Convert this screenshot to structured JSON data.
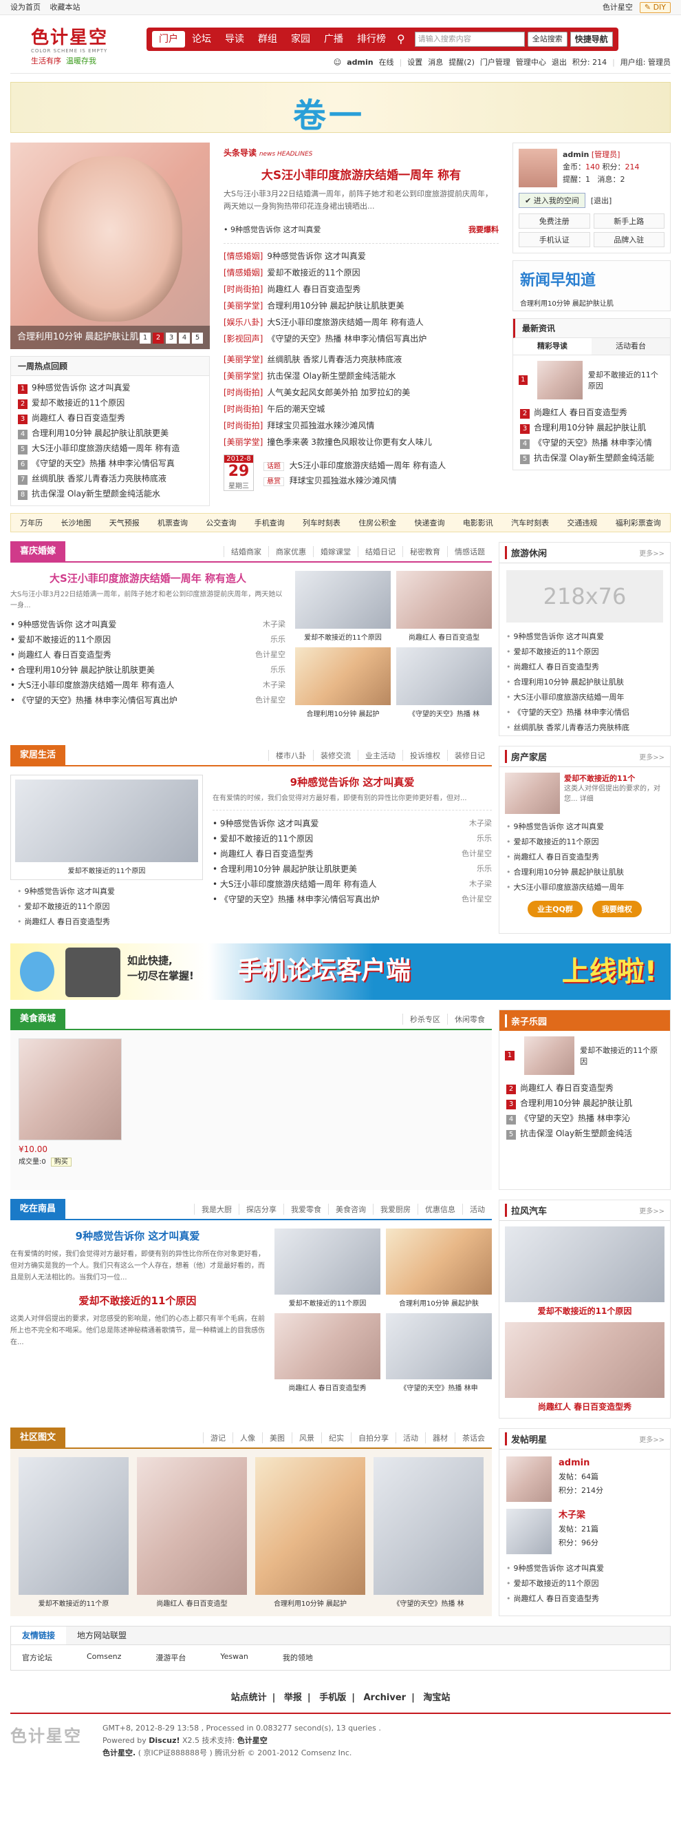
{
  "topbar": {
    "set_home": "设为首页",
    "bookmark": "收藏本站",
    "style": "色计星空",
    "diy": "DIY"
  },
  "logo": {
    "name": "色计星空",
    "en": "COLOR SCHEME IS EMPTY",
    "slogan_a": "生活有序",
    "slogan_b": "温暖存我"
  },
  "nav": {
    "items": [
      "门户",
      "论坛",
      "导读",
      "群组",
      "家园",
      "广播",
      "排行榜"
    ],
    "search_placeholder": "请输入搜索内容",
    "search_btn": "全站搜索",
    "quick_nav": "快捷导航"
  },
  "userbar": {
    "user": "admin",
    "status": "在线",
    "items": [
      "设置",
      "消息",
      "提醒(2)",
      "门户管理",
      "管理中心",
      "退出"
    ],
    "points": "积分: 214",
    "group": "用户组: 管理员"
  },
  "banner1": {
    "text": "卷一"
  },
  "slide": {
    "caption": "合理利用10分钟 晨起护肤让肌",
    "nums": [
      "1",
      "2",
      "3",
      "4",
      "5"
    ]
  },
  "hot": {
    "title": "一周热点回顾",
    "items": [
      "9种感觉告诉你 这才叫真爱",
      "爱却不敢接近的11个原因",
      "尚趣红人 春日百变造型秀",
      "合理利用10分钟 晨起护肤让肌肤更美",
      "大S汪小菲印度旅游庆结婚一周年 称有造",
      "《守望的天空》热播 林申李沁情侣写真",
      "丝绸肌肤 香浆儿青春活力亮肤柿底液",
      "抗击保湿 Olay新生塑颜金纯活能水"
    ]
  },
  "headline": {
    "tag": "头条导读",
    "tag_en": "news HEADLINES",
    "title": "大S汪小菲印度旅游庆结婚一周年 称有",
    "desc": "大S与汪小菲3月22日结婚满一周年，前阵子她才和老公到印度旅游提前庆周年，两天她以一身狗狗热带印花连身裙出镜晒出...",
    "sub": "9种感觉告诉你 这才叫真爱",
    "badge": "我要爆料"
  },
  "catlist": [
    {
      "cat": "[情感婚姻]",
      "t": "9种感觉告诉你 这才叫真爱"
    },
    {
      "cat": "[情感婚姻]",
      "t": "爱却不敢接近的11个原因"
    },
    {
      "cat": "[时尚街拍]",
      "t": "尚趣红人 春日百变造型秀"
    },
    {
      "cat": "[美丽学堂]",
      "t": "合理利用10分钟 晨起护肤让肌肤更美"
    },
    {
      "cat": "[娱乐八卦]",
      "t": "大S汪小菲印度旅游庆结婚一周年 称有造人"
    },
    {
      "cat": "[影视回声]",
      "t": "《守望的天空》热播 林申李沁情侣写真出炉"
    },
    {
      "cat": "[美丽学堂]",
      "t": "丝绸肌肤 香浆儿青春活力亮肤柿底液"
    },
    {
      "cat": "[美丽学堂]",
      "t": "抗击保湿 Olay新生塑颜金纯活能水"
    },
    {
      "cat": "[时尚街拍]",
      "t": "人气美女起风女郎美外拍 加罗拉幻的美"
    },
    {
      "cat": "[时尚街拍]",
      "t": "午后的潮天空城"
    },
    {
      "cat": "[时尚街拍]",
      "t": "拜球宝贝孤独滋水辣沙滩风情"
    },
    {
      "cat": "[美丽学堂]",
      "t": "撞色季来袭 3款撞色风眼妆让你更有女人味儿"
    }
  ],
  "datebox": {
    "month": "2012-8",
    "day": "29",
    "week": "星期三"
  },
  "datelist": [
    {
      "tag": "话题",
      "t": "大S汪小菲印度旅游庆结婚一周年 称有造人"
    },
    {
      "tag": "悬赏",
      "t": "拜球宝贝孤独滋水辣沙滩风情"
    }
  ],
  "userbox": {
    "name": "admin",
    "role": "[管理员]",
    "coins_label": "金币：",
    "coins": "140",
    "points_label": "积分：",
    "points": "214",
    "remind_label": "提醒：",
    "remind": "1",
    "msg_label": "消息：",
    "msg": "2",
    "space": "进入我的空间",
    "logout": "[退出]",
    "btns": [
      "免费注册",
      "新手上路",
      "手机认证",
      "品牌入驻"
    ]
  },
  "side_news": {
    "banner": "新闻早知道",
    "title_line": "合理利用10分钟 晨起护肤让肌",
    "title": "最新资讯",
    "tabs": [
      "精彩导读",
      "活动看台"
    ],
    "feature": "爱却不敢接近的11个原因",
    "items": [
      "尚趣红人 春日百变造型秀",
      "合理利用10分钟 晨起护肤让肌",
      "《守望的天空》热播 林申李沁情",
      "抗击保湿 Olay新生塑颜金纯活能"
    ]
  },
  "catbar": [
    "万年历",
    "长沙地图",
    "天气预报",
    "机票查询",
    "公交查询",
    "手机查询",
    "列车时刻表",
    "住房公积金",
    "快递查询",
    "电影影讯",
    "汽车时刻表",
    "交通违规",
    "福利彩票查询"
  ],
  "sec_wedding": {
    "title": "喜庆婚嫁",
    "subs": [
      "结婚商家",
      "商家优惠",
      "婚嫁课堂",
      "结婚日记",
      "秘密教育",
      "情感话题"
    ],
    "feature_title": "大S汪小菲印度旅游庆结婚一周年 称有造人",
    "feature_desc": "大S与汪小菲3月22日结婚满一周年，前阵子她才和老公到印度旅游提前庆周年，两天她以一身...",
    "rows": [
      {
        "t": "9种感觉告诉你 这才叫真爱",
        "a": "木子梁"
      },
      {
        "t": "爱却不敢接近的11个原因",
        "a": "乐乐"
      },
      {
        "t": "尚趣红人 春日百变造型秀",
        "a": "色计星空"
      },
      {
        "t": "合理利用10分钟 晨起护肤让肌肤更美",
        "a": "乐乐"
      },
      {
        "t": "大S汪小菲印度旅游庆结婚一周年 称有造人",
        "a": "木子梁"
      },
      {
        "t": "《守望的天空》热播 林申李沁情侣写真出炉",
        "a": "色计星空"
      }
    ],
    "pics": [
      "爱却不敢接近的11个原因",
      "尚趣红人 春日百变造型",
      "合理利用10分钟 晨起护",
      "《守望的天空》热播 林"
    ]
  },
  "side_travel": {
    "title": "旅游休闲",
    "more": "更多>>",
    "placeholder": "218x76",
    "items": [
      "9种感觉告诉你 这才叫真爱",
      "爱却不敢接近的11个原因",
      "尚趣红人 春日百变造型秀",
      "合理利用10分钟 晨起护肤让肌肤",
      "大S汪小菲印度旅游庆结婚一周年",
      "《守望的天空》热播 林申李沁情侣",
      "丝绸肌肤 香浆儿青春活力亮肤柿底"
    ]
  },
  "sec_home": {
    "title": "家居生活",
    "subs": [
      "楼市八卦",
      "装修交流",
      "业主活动",
      "投诉维权",
      "装修日记"
    ],
    "feature_title": "9种感觉告诉你 这才叫真爱",
    "feature_desc": "在有爱情的时候，我们会觉得对方最好看，即便有别的异性比你更帅更好看，但对...",
    "pic_cap": "爱却不敢接近的11个原因",
    "left_list": [
      "9种感觉告诉你 这才叫真爱",
      "爱却不敢接近的11个原因",
      "尚趣红人 春日百变造型秀"
    ],
    "rows": [
      {
        "t": "9种感觉告诉你 这才叫真爱",
        "a": "木子梁"
      },
      {
        "t": "爱却不敢接近的11个原因",
        "a": "乐乐"
      },
      {
        "t": "尚趣红人 春日百变造型秀",
        "a": "色计星空"
      },
      {
        "t": "合理利用10分钟 晨起护肤让肌肤更美",
        "a": "乐乐"
      },
      {
        "t": "大S汪小菲印度旅游庆结婚一周年 称有造人",
        "a": "木子梁"
      },
      {
        "t": "《守望的天空》热播 林申李沁情侣写真出炉",
        "a": "色计星空"
      }
    ]
  },
  "side_house": {
    "title": "房产家居",
    "more": "更多>>",
    "feature_title": "爱却不敢接近的11个",
    "feature_desc": "这类人对伴侣提出的要求的，对您... 详细",
    "items": [
      "9种感觉告诉你 这才叫真爱",
      "爱却不敢接近的11个原因",
      "尚趣红人 春日百变造型秀",
      "合理利用10分钟 晨起护肤让肌肤",
      "大S汪小菲印度旅游庆结婚一周年"
    ],
    "btn1": "业主QQ群",
    "btn2": "我要维权"
  },
  "banner2": {
    "t3a": "如此快捷,",
    "t3b": "一切尽在掌握!",
    "t1": "手机论坛客户端",
    "t2": "上线啦!"
  },
  "sec_food": {
    "title": "美食商城",
    "subs": [
      "秒杀专区",
      "休闲零食"
    ],
    "price": "¥10.00",
    "sold": "成交量:0",
    "buy": "购买"
  },
  "side_kids": {
    "title": "亲子乐园",
    "feature": "爱却不敢接近的11个原因",
    "items": [
      "尚趣红人 春日百变造型秀",
      "合理利用10分钟 晨起护肤让肌",
      "《守望的天空》热播 林申李沁",
      "抗击保湿 Olay新生塑颜金纯活"
    ]
  },
  "sec_eat": {
    "title": "吃在南昌",
    "subs": [
      "我是大厨",
      "探店分享",
      "我爱零食",
      "美食咨询",
      "我爱厨房",
      "优惠信息",
      "活动"
    ],
    "a1_title": "9种感觉告诉你 这才叫真爱",
    "a1_desc": "在有爱情的时候，我们会觉得对方最好看，即便有别的异性比你所在你对象更好看，但对方确实是我的一个人。我们只有这么一个人存在，想着（他）才是最好看的，而且是别人无法相比的。当我们习一位...",
    "a2_title": "爱却不敢接近的11个原因",
    "a2_desc": "这类人对伴侣提出的要求，对您感受的影响是，他们的心态上都只有半个毛病，在前所上也不完全和不喝采。他们总是陈述神秘精通着歌情节，是一种精诚上的目我感伤在...",
    "pics": [
      "爱却不敢接近的11个原因",
      "合理利用10分钟 晨起护肤",
      "尚趣红人 春日百变造型秀",
      "《守望的天空》热播 林申"
    ]
  },
  "side_car": {
    "title": "拉风汽车",
    "more": "更多>>",
    "cap1": "爱却不敢接近的11个原因",
    "cap2": "尚趣红人 春日百变造型秀"
  },
  "sec_photo": {
    "title": "社区图文",
    "subs": [
      "游记",
      "人像",
      "美图",
      "风景",
      "纪实",
      "自拍分享",
      "活动",
      "器材",
      "茶话会"
    ],
    "pics": [
      "爱却不敢接近的11个原",
      "尚趣红人 春日百变造型",
      "合理利用10分钟 晨起护",
      "《守望的天空》热播 林"
    ]
  },
  "side_stars": {
    "title": "发帖明星",
    "more": "更多>>",
    "stars": [
      {
        "name": "admin",
        "posts": "发帖：64篇",
        "points": "积分：214分"
      },
      {
        "name": "木子梁",
        "posts": "发帖：21篇",
        "points": "积分：96分"
      }
    ],
    "items": [
      "9种感觉告诉你 这才叫真爱",
      "爱却不敢接近的11个原因",
      "尚趣红人 春日百变造型秀"
    ]
  },
  "friend_links": {
    "tabs": [
      "友情链接",
      "地方网站联盟"
    ],
    "links": [
      "官方论坛",
      "Comsenz",
      "漫游平台",
      "Yeswan",
      "我的领地"
    ]
  },
  "footnav": [
    "站点统计",
    "举报",
    "手机版",
    "Archiver",
    "淘宝站"
  ],
  "footer": {
    "logo": "色计星空",
    "l1": "GMT+8, 2012-8-29 13:58 , Processed in 0.083277 second(s), 13 queries .",
    "l2a": "Powered by",
    "l2b": "Discuz!",
    "l2c": "X2.5",
    "l2d": "技术支持:",
    "l2e": "色计星空",
    "l3a": "色计星空.",
    "l3b": "( 京ICP证888888号 ) 腾讯分析 © 2001-2012 Comsenz Inc."
  }
}
